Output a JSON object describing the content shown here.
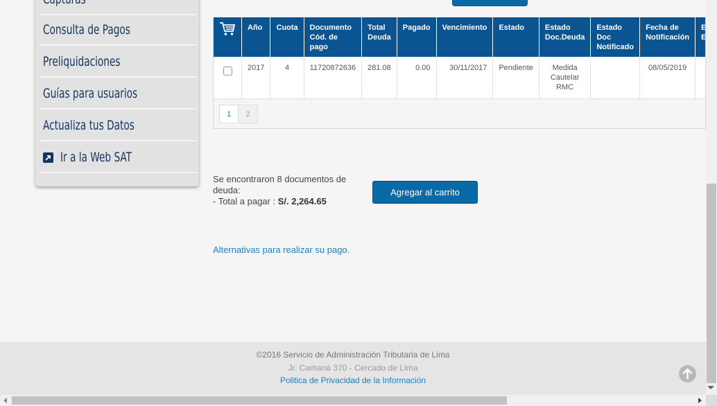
{
  "sidebar": {
    "items": [
      {
        "label": "Capturas"
      },
      {
        "label": "Consulta de Pagos"
      },
      {
        "label": "Preliquidaciones"
      },
      {
        "label": "Guías para usuarios"
      },
      {
        "label": "Actualiza tus Datos"
      },
      {
        "label": "Ir a la Web SAT",
        "icon": "external-link-icon"
      }
    ]
  },
  "table": {
    "cart_icon": "shopping-cart-icon",
    "headers": [
      "Año",
      "Cuota",
      "Documento Cód. de pago",
      "Total Deuda",
      "Pagado",
      "Vencimiento",
      "Estado",
      "Estado Doc.Deuda",
      "Estado Doc Notificado",
      "Fecha de Notificación",
      "Estado de Expediente"
    ],
    "rows": [
      {
        "anio": "2017",
        "cuota": "4",
        "documento": "11720872636",
        "total": "281.08",
        "pagado": "0.00",
        "vencimiento": "30/11/2017",
        "estado": "Pendiente",
        "estado_doc": "Medida Cautelar RMC",
        "estado_notif": "",
        "fecha_notif": "08/05/2019",
        "estado_exp": ""
      }
    ]
  },
  "pagination": {
    "pages": [
      "1",
      "2"
    ],
    "current": "1"
  },
  "summary": {
    "line1": "Se encontraron 8 documentos de deuda:",
    "total_label": "- Total a pagar : ",
    "total_value": "S/. 2,264.65"
  },
  "add_button": "Agregar al carrito",
  "alternatives_link": "Alternativas para realizar su pago.",
  "footer": {
    "copyright": "©2016 Servicio de Administración Tributaria de Lima",
    "address": "Jr. Camaná 370 - Cercado de Lima",
    "privacy": "Politica de Privacidad de la Información"
  },
  "colors": {
    "header_blue": "#0a5591",
    "button_blue": "#0a6aa8",
    "link_blue": "#1b7fc2",
    "sidebar_text": "#13355f"
  }
}
